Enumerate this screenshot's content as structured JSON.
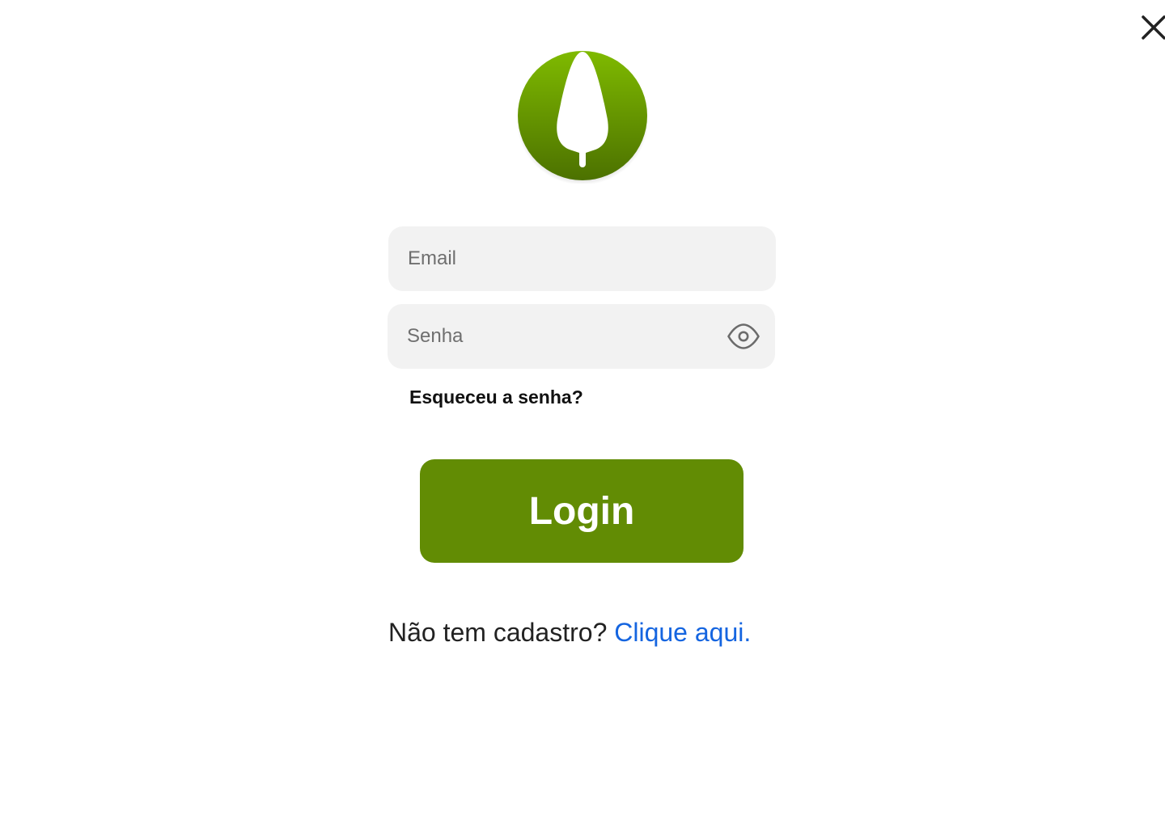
{
  "colors": {
    "brand_green": "#628c04",
    "logo_gradient_top": "#7fba00",
    "logo_gradient_bottom": "#4c7100",
    "field_background": "#f2f2f2",
    "link_blue": "#1565e0"
  },
  "header": {
    "close_icon": "close-icon"
  },
  "logo": {
    "icon": "tree-leaf-logo"
  },
  "form": {
    "email_placeholder": "Email",
    "password_placeholder": "Senha",
    "show_password_icon": "eye-icon",
    "forgot_password_label": "Esqueceu a senha?",
    "login_button_label": "Login"
  },
  "signup": {
    "prompt": "Não tem cadastro?",
    "link_label": "Clique aqui."
  }
}
